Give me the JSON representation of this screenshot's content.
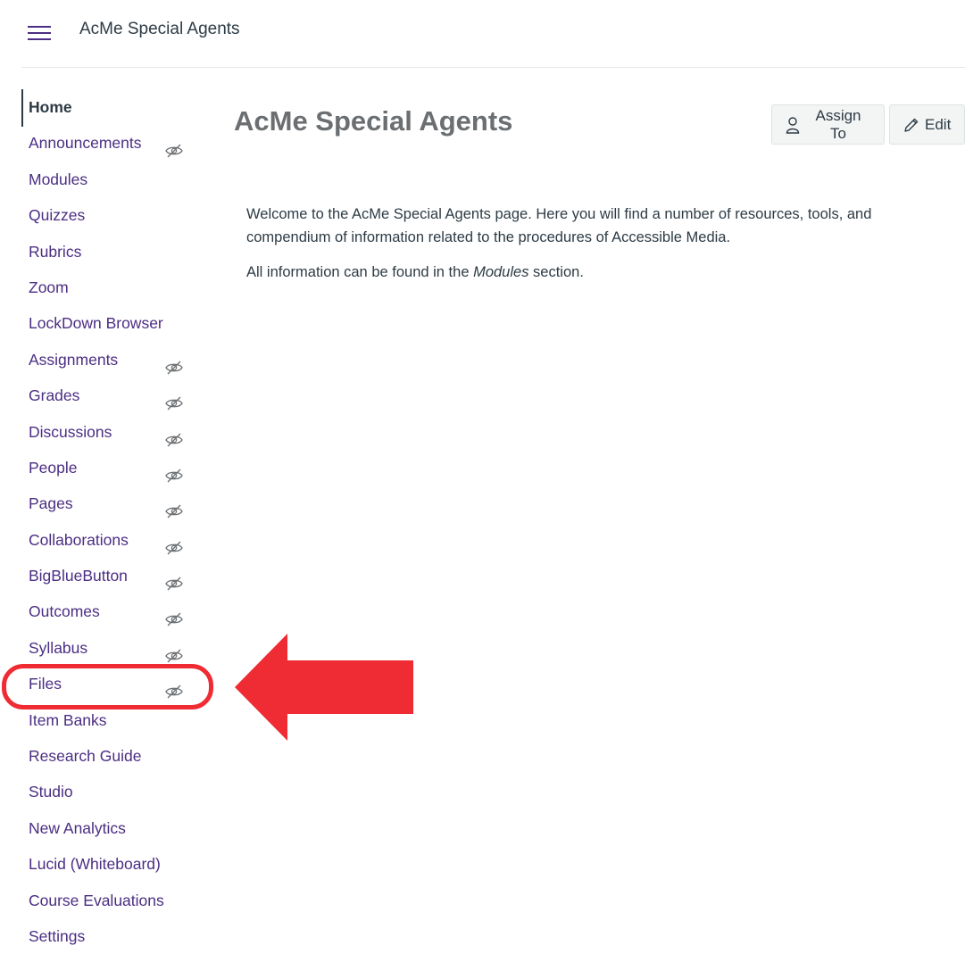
{
  "header": {
    "menu_icon": "hamburger-icon",
    "course_name": "AcMe Special Agents"
  },
  "nav": {
    "items": [
      {
        "label": "Home",
        "active": true,
        "hidden": false
      },
      {
        "label": "Announcements",
        "hidden": true
      },
      {
        "label": "Modules",
        "hidden": false
      },
      {
        "label": "Quizzes",
        "hidden": false
      },
      {
        "label": "Rubrics",
        "hidden": false
      },
      {
        "label": "Zoom",
        "hidden": false
      },
      {
        "label": "LockDown Browser",
        "hidden": false
      },
      {
        "label": "Assignments",
        "hidden": true
      },
      {
        "label": "Grades",
        "hidden": true
      },
      {
        "label": "Discussions",
        "hidden": true
      },
      {
        "label": "People",
        "hidden": true
      },
      {
        "label": "Pages",
        "hidden": true
      },
      {
        "label": "Collaborations",
        "hidden": true
      },
      {
        "label": "BigBlueButton",
        "hidden": true
      },
      {
        "label": "Outcomes",
        "hidden": true
      },
      {
        "label": "Syllabus",
        "hidden": true
      },
      {
        "label": "Files",
        "hidden": true
      },
      {
        "label": "Item Banks",
        "hidden": false
      },
      {
        "label": "Research Guide",
        "hidden": false
      },
      {
        "label": "Studio",
        "hidden": false
      },
      {
        "label": "New Analytics",
        "hidden": false
      },
      {
        "label": "Lucid (Whiteboard)",
        "hidden": false
      },
      {
        "label": "Course Evaluations",
        "hidden": false
      },
      {
        "label": "Settings",
        "hidden": false
      }
    ],
    "hidden_icon": "eye-slash-icon"
  },
  "main": {
    "title": "AcMe Special Agents",
    "assign_label": "Assign To",
    "edit_label": "Edit",
    "intro": "Welcome to the AcMe Special Agents page. Here you will find a number of resources, tools, and compendium of information related to the procedures of Accessible Media.",
    "modules_prefix": "All information can be found in the ",
    "modules_word": "Modules",
    "modules_suffix": " section."
  },
  "colors": {
    "link": "#4b2e83",
    "text": "#2d3b45",
    "annotation": "#ef2b33"
  }
}
